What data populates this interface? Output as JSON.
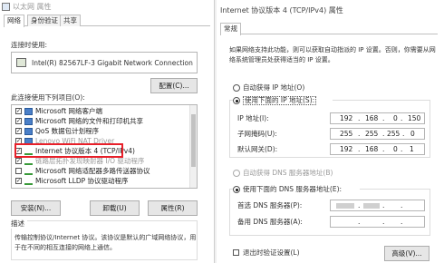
{
  "left": {
    "title": "以太网 属性",
    "tabs": [
      {
        "label": "网络"
      },
      {
        "label": "身份验证"
      },
      {
        "label": "共享"
      }
    ],
    "connect_label": "连接时使用:",
    "adapter": "Intel(R) 82567LF-3 Gigabit Network Connection",
    "configure_button": "配置(C)...",
    "items_label": "此连接使用下列项目(O):",
    "items": [
      {
        "label": "Microsoft 网络客户端",
        "checked": "✓"
      },
      {
        "label": "Microsoft 网络的文件和打印机共享",
        "checked": "✓"
      },
      {
        "label": "QoS 数据包计划程序",
        "checked": "✓"
      },
      {
        "label": "Lenovo WiFi NAT Driver",
        "checked": "✓"
      },
      {
        "label": "Internet 协议版本 4 (TCP/IPv4)",
        "checked": "✓"
      },
      {
        "label": "链路层拓扑发现映射器 I/O 驱动程序",
        "checked": "✓"
      },
      {
        "label": "Microsoft 网络适配器多路传送器协议",
        "checked": ""
      },
      {
        "label": "Microsoft LLDP 协议驱动程序",
        "checked": "✓"
      }
    ],
    "install_button": "安装(N)...",
    "uninstall_button": "卸载(U)",
    "properties_button": "属性(R)",
    "description_title": "描述",
    "description_text_1": "传输控制协议/Internet 协议。该协议是默认的广域网络协议，用",
    "description_text_2": "于在不同的相互连接的网络上通信。",
    "highlight_color": "#e8202a"
  },
  "right": {
    "title": "Internet 协议版本 4 (TCP/IPv4) 属性",
    "tab": "常规",
    "intro_1": "如果网络支持此功能，则可以获取自动指派的 IP 设置。否则，你需要从网",
    "intro_2": "络系统管理员处获得适当的 IP 设置。",
    "auto_ip": "自动获得 IP 地址(O)",
    "manual_ip": "使用下面的 IP 地址(S):",
    "ip_label": "IP 地址(I):",
    "ip": [
      "192",
      "168",
      "0",
      "150"
    ],
    "mask_label": "子网掩码(U):",
    "mask": [
      "255",
      "255",
      "255",
      "0"
    ],
    "gateway_label": "默认网关(D):",
    "gateway": [
      "192",
      "168",
      "0",
      "1"
    ],
    "auto_dns": "自动获得 DNS 服务器地址(B)",
    "manual_dns": "使用下面的 DNS 服务器地址(E):",
    "dns1_label": "首选 DNS 服务器(P):",
    "dns2_label": "备用 DNS 服务器(A):",
    "validate": "退出时验证设置(L)",
    "advanced_button": "高级(V)..."
  }
}
